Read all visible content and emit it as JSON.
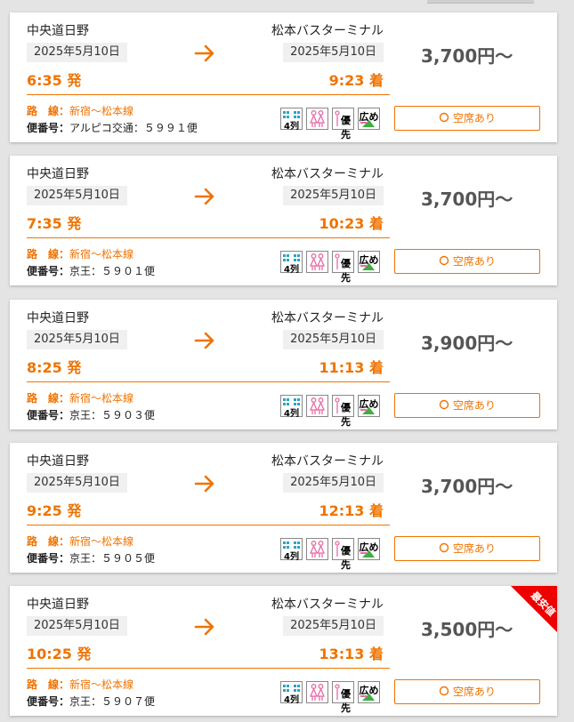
{
  "colors": {
    "accent": "#f07300",
    "price": "#555555",
    "badge_red": "#ee0000"
  },
  "labels": {
    "departure_suffix": "発",
    "arrival_suffix": "着",
    "route_label": "路　線：",
    "flight_label": "便番号：",
    "availability": "空席あり",
    "availability_icon": "circle-icon"
  },
  "amenity_icons": [
    {
      "name": "4-row-seat-icon",
      "text": "4列"
    },
    {
      "name": "women-seat-icon",
      "text": ""
    },
    {
      "name": "priority-seat-icon",
      "text": "優先"
    },
    {
      "name": "wide-seat-icon",
      "text": "広め"
    }
  ],
  "results": [
    {
      "from": "中央道日野",
      "to": "松本バスターミナル",
      "dep_date": "2025年5月10日",
      "arr_date": "2025年5月10日",
      "dep_time": "6:35 発",
      "arr_time": "9:23 着",
      "price": "3,700円～",
      "route": "新宿～松本線",
      "flight": "アルピコ交通：５９９１便",
      "cheapest": false
    },
    {
      "from": "中央道日野",
      "to": "松本バスターミナル",
      "dep_date": "2025年5月10日",
      "arr_date": "2025年5月10日",
      "dep_time": "7:35 発",
      "arr_time": "10:23 着",
      "price": "3,700円～",
      "route": "新宿～松本線",
      "flight": "京王：５９０１便",
      "cheapest": false
    },
    {
      "from": "中央道日野",
      "to": "松本バスターミナル",
      "dep_date": "2025年5月10日",
      "arr_date": "2025年5月10日",
      "dep_time": "8:25 発",
      "arr_time": "11:13 着",
      "price": "3,900円～",
      "route": "新宿～松本線",
      "flight": "京王：５９０３便",
      "cheapest": false
    },
    {
      "from": "中央道日野",
      "to": "松本バスターミナル",
      "dep_date": "2025年5月10日",
      "arr_date": "2025年5月10日",
      "dep_time": "9:25 発",
      "arr_time": "12:13 着",
      "price": "3,700円～",
      "route": "新宿～松本線",
      "flight": "京王：５９０５便",
      "cheapest": false
    },
    {
      "from": "中央道日野",
      "to": "松本バスターミナル",
      "dep_date": "2025年5月10日",
      "arr_date": "2025年5月10日",
      "dep_time": "10:25 発",
      "arr_time": "13:13 着",
      "price": "3,500円～",
      "route": "新宿～松本線",
      "flight": "京王：５９０７便",
      "cheapest": true,
      "badge": "最安値"
    }
  ]
}
